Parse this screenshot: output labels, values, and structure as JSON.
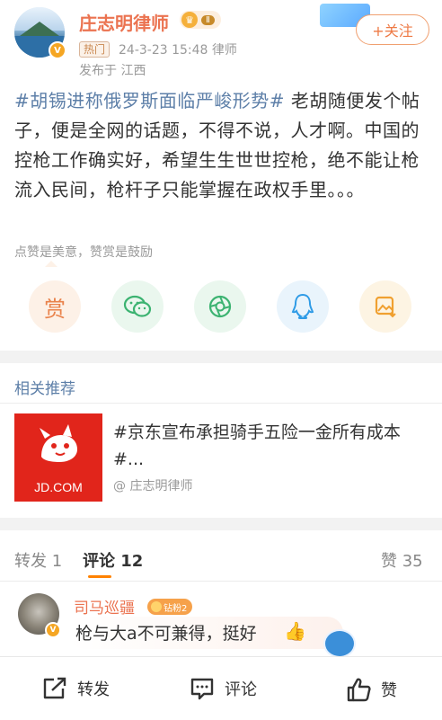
{
  "author": {
    "name": "庄志明律师",
    "level": "Ⅱ",
    "follow_label": "+关注",
    "hot_tag": "热门",
    "time_source": "24-3-23 15:48  律师",
    "location": "发布于 江西"
  },
  "post": {
    "topic": "#胡锡进称俄罗斯面临严峻形势#",
    "text": "  老胡随便发个帖子，便是全网的话题，不得不说，人才啊。中国的控枪工作确实好，希望生生世世控枪，绝不能让枪流入民间，枪杆子只能掌握在政权手里。。。"
  },
  "reward": {
    "hint": "点赞是美意，赞赏是鼓励",
    "reward_label": "赏"
  },
  "share_icons": [
    "reward-icon",
    "wechat-icon",
    "moments-icon",
    "qq-icon",
    "save-image-icon"
  ],
  "related": {
    "title": "相关推荐",
    "item_logo_text": "JD.COM",
    "item_text": "#京东宣布承担骑手五险一金所有成本#...",
    "item_author": "@ 庄志明律师"
  },
  "tabs": {
    "repost": "转发 1",
    "comments": "评论 12",
    "likes": "赞 35"
  },
  "comment": {
    "name": "司马巡疆",
    "fan_badge": "钻粉2",
    "text": "枪与大a不可兼得，挺好",
    "emoji": "👍"
  },
  "bottom_bar": {
    "repost": "转发",
    "comment": "评论",
    "like": "赞"
  },
  "colors": {
    "name_orange": "#eb7350",
    "topic_blue": "#5d7fa8",
    "accent": "#ff8200",
    "jd_red": "#e1251b"
  }
}
